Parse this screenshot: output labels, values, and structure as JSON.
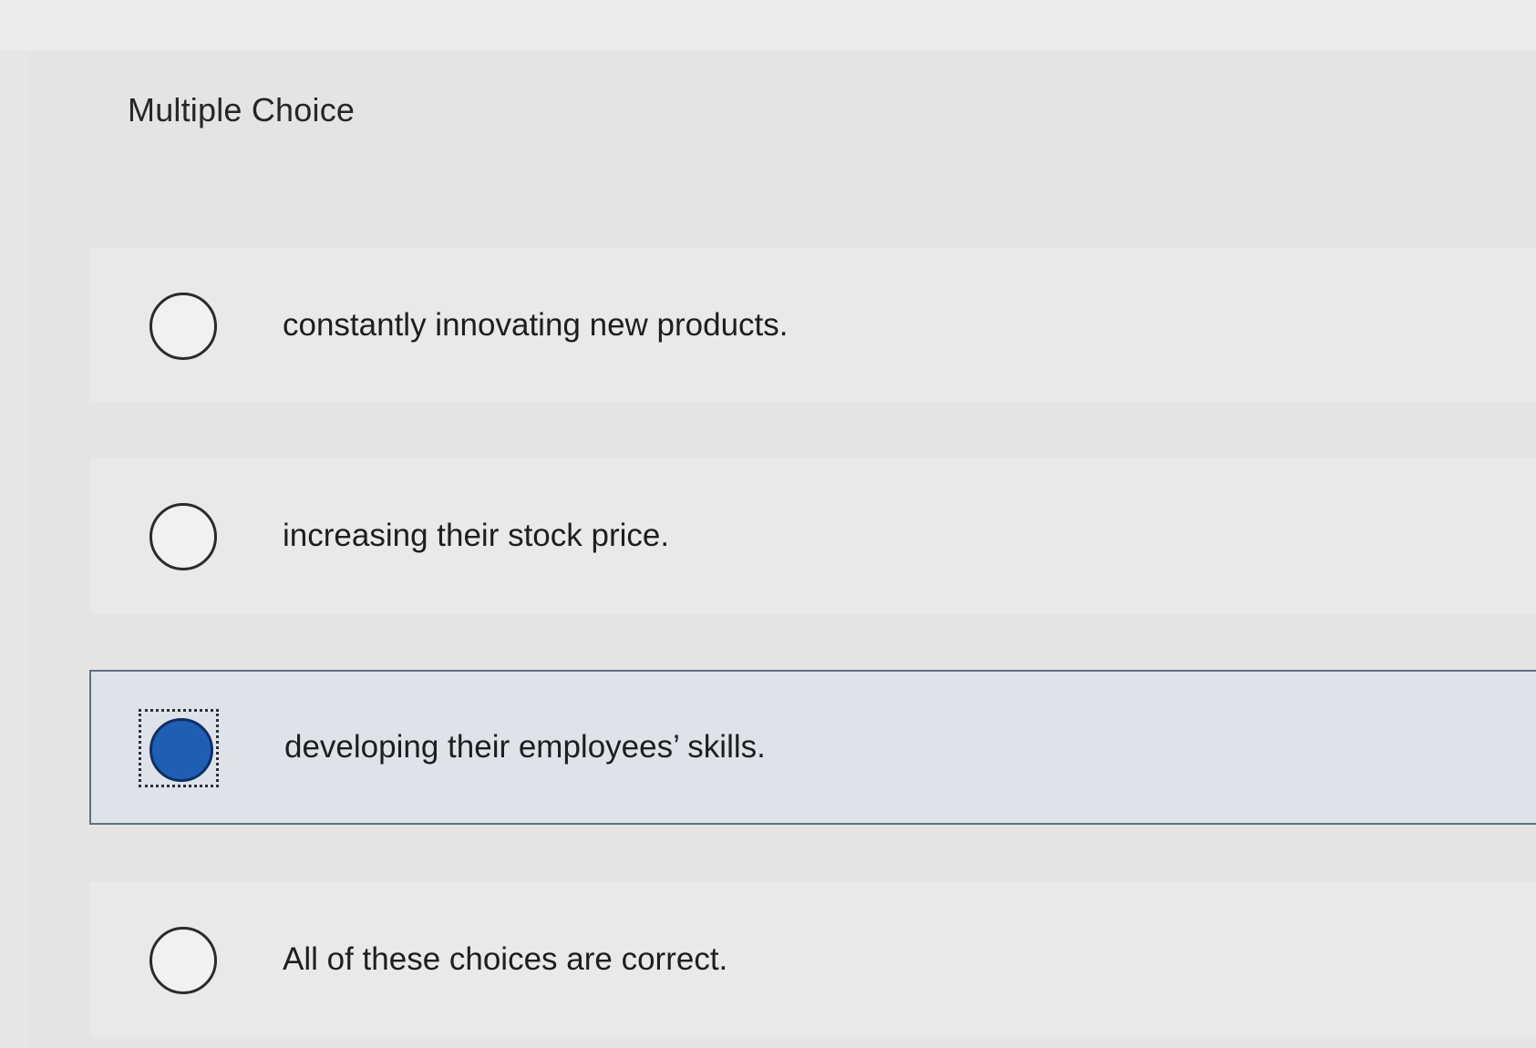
{
  "question": {
    "heading": "Multiple Choice"
  },
  "choices": [
    {
      "label": "constantly innovating new products.",
      "selected": false
    },
    {
      "label": "increasing their stock price.",
      "selected": false
    },
    {
      "label": "developing their employees’ skills.",
      "selected": true
    },
    {
      "label": "All of these choices are correct.",
      "selected": false
    }
  ],
  "colors": {
    "selected_fill": "#1f5fb3",
    "selected_row": "#dde3e9",
    "selected_border": "#5d6f82"
  }
}
